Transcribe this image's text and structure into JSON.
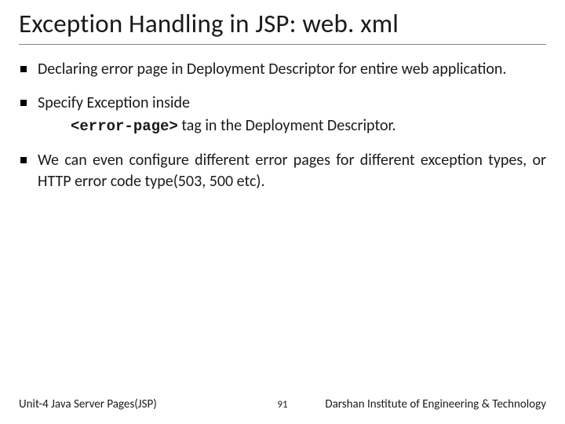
{
  "title": "Exception Handling in JSP: web. xml",
  "bullets": [
    {
      "text": "Declaring error page in Deployment Descriptor for entire web application."
    },
    {
      "text": "Specify Exception inside",
      "code": "<error-page>",
      "subtext": " tag in the Deployment Descriptor."
    },
    {
      "text": "We can even configure different error pages for different exception types, or HTTP error code type(503, 500 etc)."
    }
  ],
  "footer": {
    "left": "Unit-4 Java Server Pages(JSP)",
    "center": "91",
    "right": "Darshan Institute of Engineering & Technology"
  }
}
